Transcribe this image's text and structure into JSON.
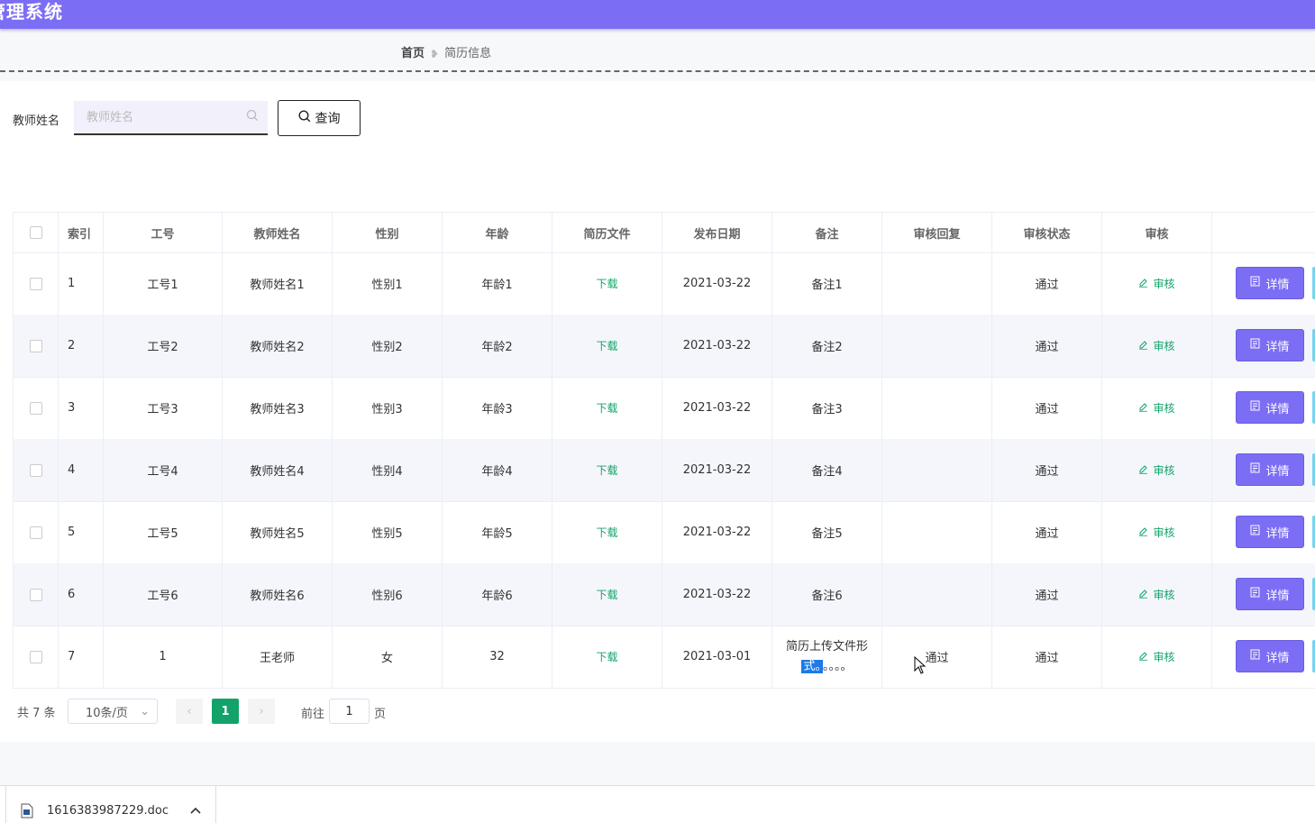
{
  "app": {
    "title": "管理系统"
  },
  "breadcrumb": {
    "home": "首页",
    "current": "简历信息"
  },
  "search": {
    "label": "教师姓名",
    "placeholder": "教师姓名",
    "value": "",
    "button": "查询"
  },
  "table": {
    "headers": [
      "",
      "索引",
      "工号",
      "教师姓名",
      "性别",
      "年龄",
      "简历文件",
      "发布日期",
      "备注",
      "审核回复",
      "审核状态",
      "审核",
      ""
    ],
    "rows": [
      {
        "index": "1",
        "no": "工号1",
        "name": "教师姓名1",
        "gender": "性别1",
        "age": "年龄1",
        "file": "下载",
        "date": "2021-03-22",
        "note": "备注1",
        "reply": "",
        "status": "通过",
        "review": "审核",
        "action": "详情"
      },
      {
        "index": "2",
        "no": "工号2",
        "name": "教师姓名2",
        "gender": "性别2",
        "age": "年龄2",
        "file": "下载",
        "date": "2021-03-22",
        "note": "备注2",
        "reply": "",
        "status": "通过",
        "review": "审核",
        "action": "详情"
      },
      {
        "index": "3",
        "no": "工号3",
        "name": "教师姓名3",
        "gender": "性别3",
        "age": "年龄3",
        "file": "下载",
        "date": "2021-03-22",
        "note": "备注3",
        "reply": "",
        "status": "通过",
        "review": "审核",
        "action": "详情"
      },
      {
        "index": "4",
        "no": "工号4",
        "name": "教师姓名4",
        "gender": "性别4",
        "age": "年龄4",
        "file": "下载",
        "date": "2021-03-22",
        "note": "备注4",
        "reply": "",
        "status": "通过",
        "review": "审核",
        "action": "详情"
      },
      {
        "index": "5",
        "no": "工号5",
        "name": "教师姓名5",
        "gender": "性别5",
        "age": "年龄5",
        "file": "下载",
        "date": "2021-03-22",
        "note": "备注5",
        "reply": "",
        "status": "通过",
        "review": "审核",
        "action": "详情"
      },
      {
        "index": "6",
        "no": "工号6",
        "name": "教师姓名6",
        "gender": "性别6",
        "age": "年龄6",
        "file": "下载",
        "date": "2021-03-22",
        "note": "备注6",
        "reply": "",
        "status": "通过",
        "review": "审核",
        "action": "详情"
      },
      {
        "index": "7",
        "no": "1",
        "name": "王老师",
        "gender": "女",
        "age": "32",
        "file": "下载",
        "date": "2021-03-01",
        "note_line1": "简历上传文件形",
        "note_sel": "式。",
        "note_rest": "。。。。",
        "reply": "通过",
        "status": "通过",
        "review": "审核",
        "action": "详情"
      }
    ]
  },
  "pagination": {
    "total": "共 7 条",
    "page_size": "10条/页",
    "current_page": "1",
    "goto_label": "前往",
    "goto_value": "1",
    "page_unit": "页"
  },
  "download": {
    "filename": "1616383987229.doc"
  },
  "colors": {
    "accent": "#7b6ef5",
    "success": "#13a36a"
  }
}
